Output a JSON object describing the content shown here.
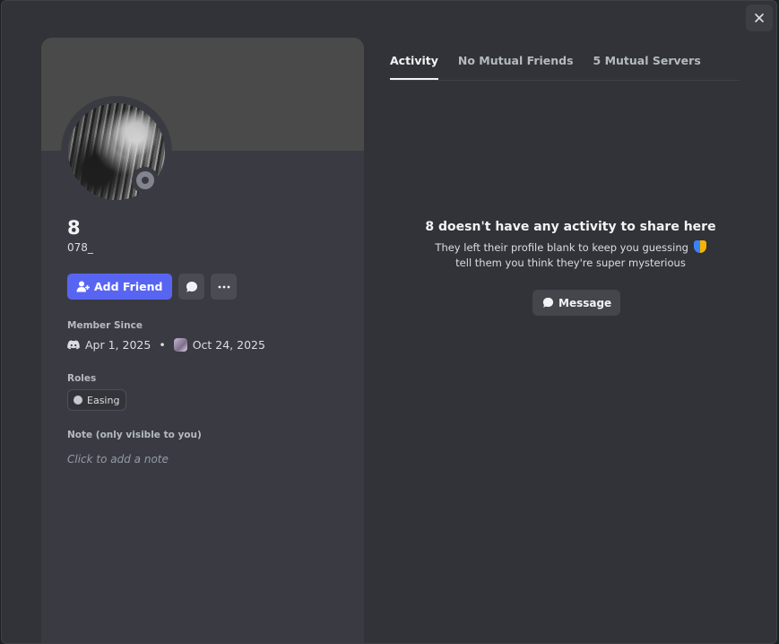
{
  "profile": {
    "display_name": "8",
    "username": "078_",
    "add_friend_label": "Add Friend",
    "member_since_label": "Member Since",
    "discord_joined": "Apr 1, 2025",
    "server_joined": "Oct 24, 2025",
    "separator": "•",
    "roles_label": "Roles",
    "roles": [
      {
        "name": "Easing",
        "color": "#c4c9ce"
      }
    ],
    "note_label": "Note (only visible to you)",
    "note_placeholder": "Click to add a note",
    "status": "offline"
  },
  "tabs": [
    {
      "label": "Activity",
      "active": true
    },
    {
      "label": "No Mutual Friends",
      "active": false
    },
    {
      "label": "5 Mutual Servers",
      "active": false
    }
  ],
  "activity": {
    "title": "8 doesn't have any activity to share here",
    "line1": "They left their profile blank to keep you guessing",
    "line2": "tell them you think they're super mysterious",
    "message_button": "Message"
  },
  "colors": {
    "accent": "#5865f2",
    "modal_bg": "#313338",
    "panel_bg": "#3a3b42",
    "banner": "#4a4a4a"
  },
  "icons": {
    "close": "close-icon",
    "add_friend": "add-friend-icon",
    "message": "chat-bubble-icon",
    "more": "more-icon",
    "discord": "discord-icon"
  }
}
